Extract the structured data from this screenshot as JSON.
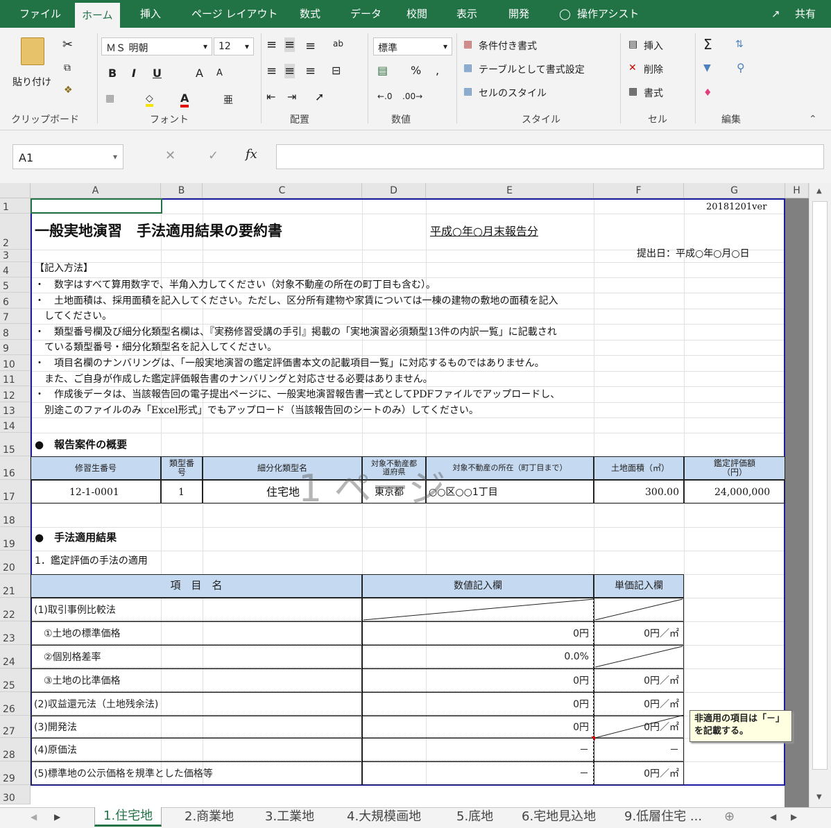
{
  "ribbon_tabs": [
    "ファイル",
    "ホーム",
    "挿入",
    "ページ レイアウト",
    "数式",
    "データ",
    "校閲",
    "表示",
    "開発",
    "操作アシスト"
  ],
  "share_label": "共有",
  "ribbon": {
    "paste": "貼り付け",
    "font_name": "ＭＳ 明朝",
    "font_size": "12",
    "bold": "B",
    "italic": "I",
    "underline": "U",
    "grow": "A",
    "shrink": "A",
    "num_format": "標準",
    "percent": "%",
    "comma": ",",
    "cond_format": "条件付き書式",
    "table_format": "テーブルとして書式設定",
    "cell_style": "セルのスタイル",
    "insert": "挿入",
    "delete": "削除",
    "format": "書式",
    "groups": [
      "クリップボード",
      "フォント",
      "配置",
      "数値",
      "スタイル",
      "セル",
      "編集"
    ]
  },
  "name_box": "A1",
  "columns": [
    "A",
    "B",
    "C",
    "D",
    "E",
    "F",
    "G"
  ],
  "rows": [
    "1",
    "2",
    "3",
    "4",
    "5",
    "6",
    "7",
    "8",
    "9",
    "10",
    "11",
    "12",
    "13",
    "14",
    "15",
    "16",
    "17",
    "18",
    "19",
    "20",
    "21",
    "22",
    "23",
    "24",
    "25",
    "26",
    "27",
    "28",
    "29",
    "30"
  ],
  "sheet": {
    "version": "20181201ver",
    "title": "一般実地演習　手法適用結果の要約書",
    "report_period": "平成○年○月末報告分",
    "submit_date": "提出日：平成○年○月○日",
    "instr_heading": "【記入方法】",
    "instructions": [
      "・　数字はすべて算用数字で、半角入力してください（対象不動産の所在の町丁目も含む）。",
      "・　土地面積は、採用面積を記入してください。ただし、区分所有建物や家賃については一棟の建物の敷地の面積を記入",
      "　してください。",
      "・　類型番号欄及び細分化類型名欄は、『実務修習受講の手引』掲載の「実地演習必須類型13件の内訳一覧」に記載され",
      "　ている類型番号・細分化類型名を記入してください。",
      "・　項目名欄のナンバリングは、「一般実地演習の鑑定評価書本文の記載項目一覧」に対応するものではありません。",
      "　また、ご自身が作成した鑑定評価報告書のナンバリングと対応させる必要はありません。",
      "・　作成後データは、当該報告回の電子提出ページに、一般実地演習報告書一式としてPDFファイルでアップロードし、",
      "　別途このファイルのみ「Excel形式」でもアップロード（当該報告回のシートのみ）してください。"
    ],
    "section1": "●　報告案件の概要",
    "overview_headers": [
      "修習生番号",
      "類型番号",
      "細分化類型名",
      "対象不動産都道府県",
      "対象不動産の所在（町丁目まで）",
      "土地面積（㎡）",
      "鑑定評価額（円）"
    ],
    "overview_values": [
      "12-1-0001",
      "1",
      "住宅地",
      "東京都",
      "○○区○○1丁目",
      "300.00",
      "24,000,000"
    ],
    "watermark": "1 ページ",
    "section2": "●　手法適用結果",
    "subsection": "1．鑑定評価の手法の適用",
    "table_headers": [
      "項　目　名",
      "数値記入欄",
      "単価記入欄"
    ],
    "items": [
      {
        "name": "(1)取引事例比較法",
        "value": "",
        "unit": ""
      },
      {
        "name": "　①土地の標準価格",
        "value": "0円",
        "unit": "0円／㎡"
      },
      {
        "name": "　②個別格差率",
        "value": "0.0%",
        "unit": ""
      },
      {
        "name": "　③土地の比準価格",
        "value": "0円",
        "unit": "0円／㎡"
      },
      {
        "name": "(2)収益還元法（土地残余法)",
        "value": "0円",
        "unit": "0円／㎡"
      },
      {
        "name": "(3)開発法",
        "value": "0円",
        "unit": "0円／㎡"
      },
      {
        "name": "(4)原価法",
        "value": "－",
        "unit": "－"
      },
      {
        "name": "(5)標準地の公示価格を規準とした価格等",
        "value": "－",
        "unit": "0円／㎡"
      }
    ],
    "comment": "非適用の項目は「－」を記載する。"
  },
  "sheet_tabs": [
    "1.住宅地",
    "2.商業地",
    "3.工業地",
    "4.大規模画地",
    "5.底地",
    "6.宅地見込地",
    "9.低層住宅 ..."
  ]
}
